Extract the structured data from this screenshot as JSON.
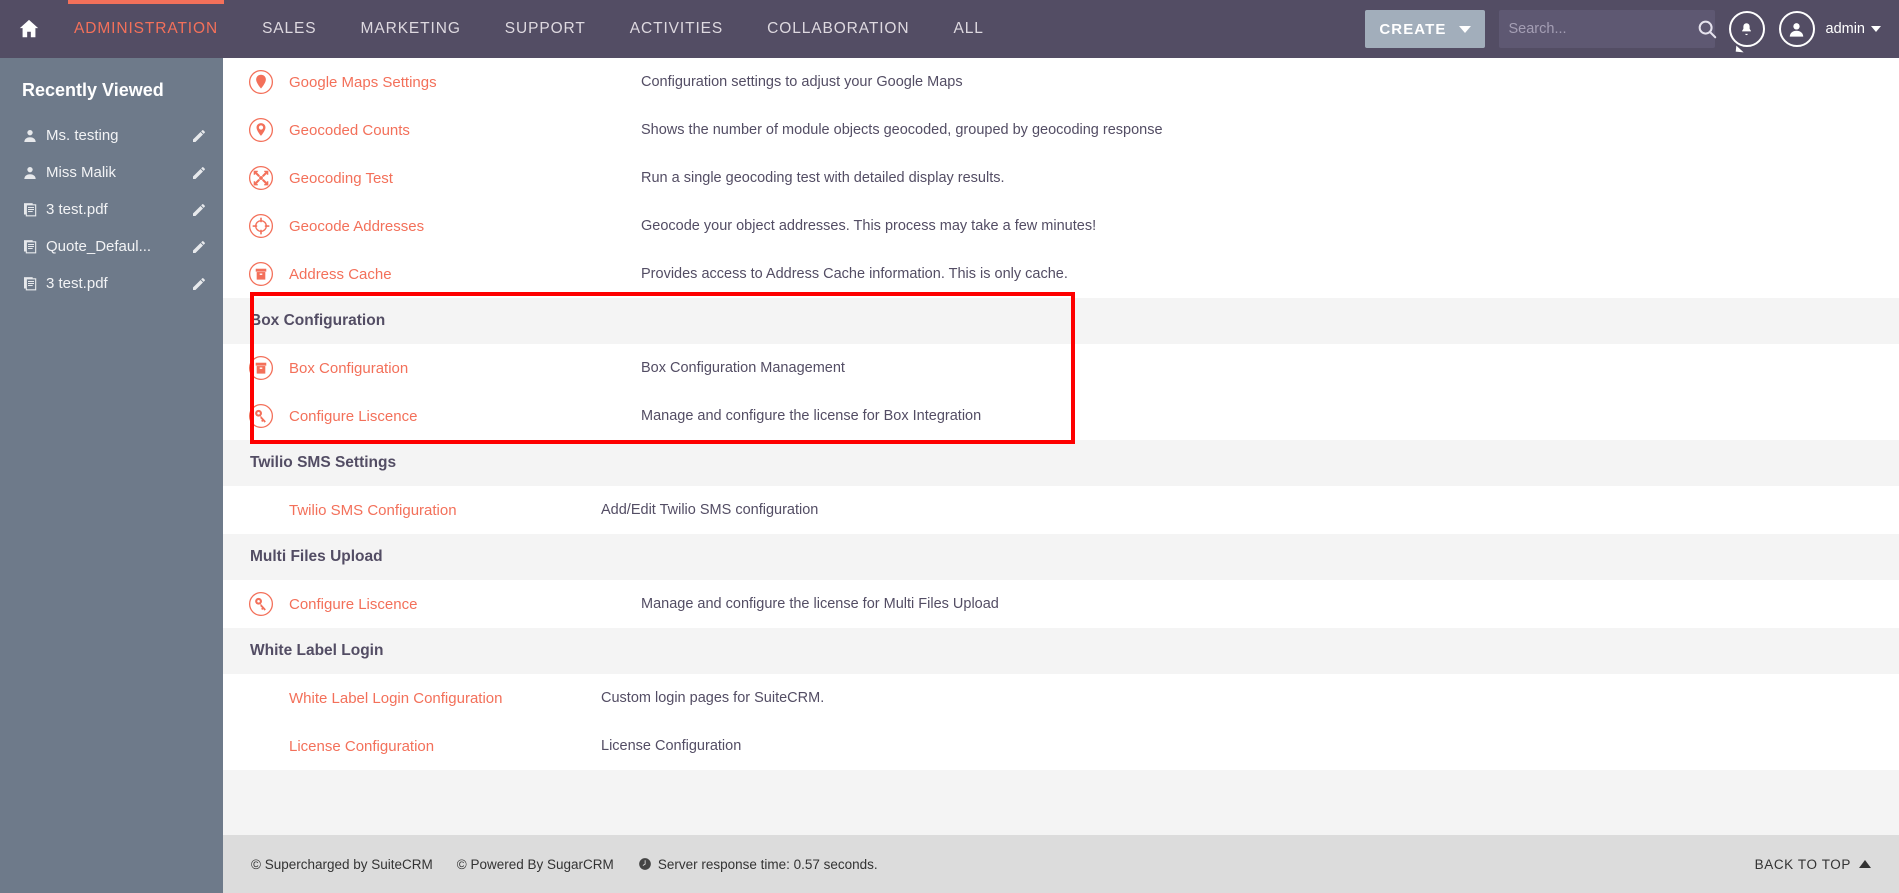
{
  "topnav": {
    "home_icon": "home-icon",
    "items": [
      {
        "label": "ADMINISTRATION",
        "active": true
      },
      {
        "label": "SALES",
        "active": false
      },
      {
        "label": "MARKETING",
        "active": false
      },
      {
        "label": "SUPPORT",
        "active": false
      },
      {
        "label": "ACTIVITIES",
        "active": false
      },
      {
        "label": "COLLABORATION",
        "active": false
      },
      {
        "label": "ALL",
        "active": false
      }
    ],
    "create_label": "CREATE",
    "search_placeholder": "Search...",
    "search_value": "",
    "admin_label": "admin",
    "accent_color": "#f3705a",
    "bar_color": "#534d64"
  },
  "sidebar": {
    "title": "Recently Viewed",
    "items": [
      {
        "label": "Ms. testing",
        "icon": "user-icon"
      },
      {
        "label": "Miss Malik",
        "icon": "user-icon"
      },
      {
        "label": "3 test.pdf",
        "icon": "document-icon"
      },
      {
        "label": "Quote_Defaul...",
        "icon": "document-icon"
      },
      {
        "label": "3 test.pdf",
        "icon": "document-icon"
      }
    ],
    "edit_icon": "pencil-icon",
    "collapse_icon": "collapse-left-icon",
    "bg_color": "#6e7a8a"
  },
  "main": {
    "sections": [
      {
        "title": null,
        "rows": [
          {
            "icon": "map-pin-filled-icon",
            "label": "Google Maps Settings",
            "desc": "Configuration settings to adjust your Google Maps"
          },
          {
            "icon": "map-pin-star-icon",
            "label": "Geocoded Counts",
            "desc": "Shows the number of module objects geocoded, grouped by geocoding response"
          },
          {
            "icon": "expand-arrows-icon",
            "label": "Geocoding Test",
            "desc": "Run a single geocoding test with detailed display results."
          },
          {
            "icon": "crosshair-icon",
            "label": "Geocode Addresses",
            "desc": "Geocode your object addresses. This process may take a few minutes!"
          },
          {
            "icon": "archive-box-icon",
            "label": "Address Cache",
            "desc": "Provides access to Address Cache information. This is only cache."
          }
        ]
      },
      {
        "title": "Box Configuration",
        "highlighted": true,
        "rows": [
          {
            "icon": "archive-box-icon",
            "label": "Box Configuration",
            "desc": "Box Configuration Management"
          },
          {
            "icon": "key-icon",
            "label": "Configure Liscence",
            "desc": "Manage and configure the license for Box Integration"
          }
        ]
      },
      {
        "title": "Twilio SMS Settings",
        "rows": [
          {
            "icon": null,
            "label": "Twilio SMS Configuration",
            "desc": "Add/Edit Twilio SMS configuration"
          }
        ]
      },
      {
        "title": "Multi Files Upload",
        "rows": [
          {
            "icon": "key-icon",
            "label": "Configure Liscence",
            "desc": "Manage and configure the license for Multi Files Upload"
          }
        ]
      },
      {
        "title": "White Label Login",
        "rows": [
          {
            "icon": null,
            "label": "White Label Login Configuration",
            "desc": "Custom login pages for SuiteCRM."
          },
          {
            "icon": null,
            "label": "License Configuration",
            "desc": "License Configuration"
          }
        ]
      }
    ],
    "highlight_color": "#fe0000"
  },
  "footer": {
    "supercharged": "© Supercharged by SuiteCRM",
    "powered": "© Powered By SugarCRM",
    "response_time": "Server response time: 0.57 seconds.",
    "clock_icon": "clock-icon",
    "back_to_top": "BACK TO TOP"
  }
}
